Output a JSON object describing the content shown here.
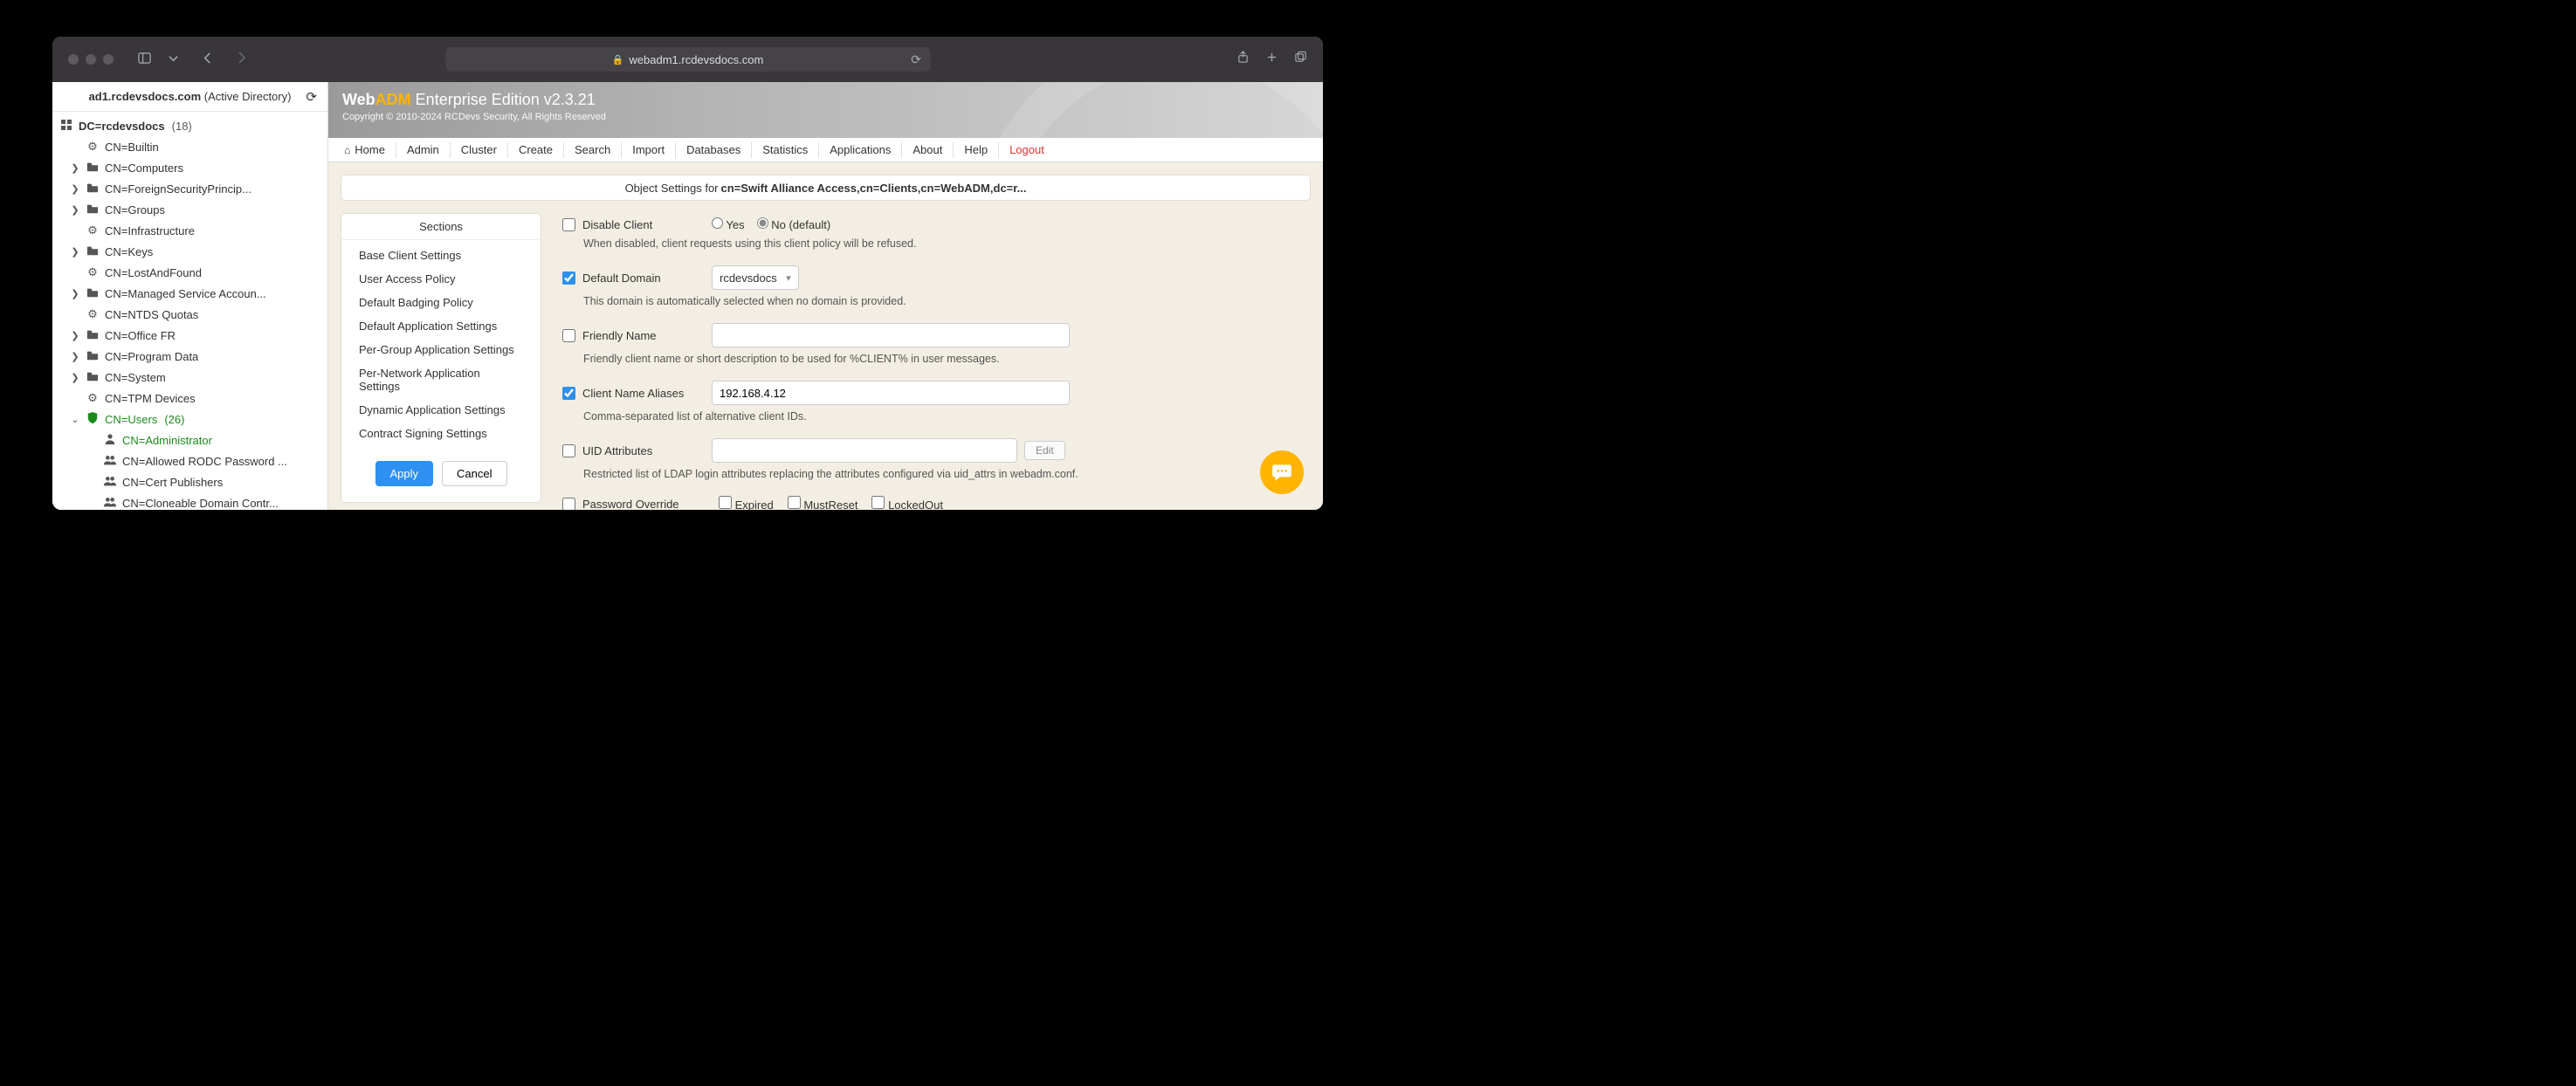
{
  "browser": {
    "url_host": "webadm1.rcdevsdocs.com"
  },
  "left_pane": {
    "header_domain": "ad1.rcdevsdocs.com",
    "header_suffix": " (Active Directory)",
    "root": {
      "label": "DC=rcdevsdocs",
      "count": "(18)"
    },
    "nodes": [
      {
        "icon": "globes",
        "label": "CN=Builtin",
        "chev": "none",
        "depth": 1
      },
      {
        "icon": "folder",
        "label": "CN=Computers",
        "chev": "right",
        "depth": 1
      },
      {
        "icon": "folder",
        "label": "CN=ForeignSecurityPrincip...",
        "chev": "right",
        "depth": 1
      },
      {
        "icon": "folder",
        "label": "CN=Groups",
        "chev": "right",
        "depth": 1
      },
      {
        "icon": "globes",
        "label": "CN=Infrastructure",
        "chev": "none",
        "depth": 1
      },
      {
        "icon": "folder",
        "label": "CN=Keys",
        "chev": "right",
        "depth": 1
      },
      {
        "icon": "globes",
        "label": "CN=LostAndFound",
        "chev": "none",
        "depth": 1
      },
      {
        "icon": "folder",
        "label": "CN=Managed Service Accoun...",
        "chev": "right",
        "depth": 1
      },
      {
        "icon": "globes",
        "label": "CN=NTDS Quotas",
        "chev": "none",
        "depth": 1
      },
      {
        "icon": "folder",
        "label": "CN=Office FR",
        "chev": "right",
        "depth": 1
      },
      {
        "icon": "folder",
        "label": "CN=Program Data",
        "chev": "right",
        "depth": 1
      },
      {
        "icon": "folder",
        "label": "CN=System",
        "chev": "right",
        "depth": 1
      },
      {
        "icon": "globes",
        "label": "CN=TPM Devices",
        "chev": "none",
        "depth": 1
      },
      {
        "icon": "shield",
        "label": "CN=Users",
        "count": "(26)",
        "chev": "down",
        "depth": 1,
        "green": true
      },
      {
        "icon": "user",
        "label": "CN=Administrator",
        "chev": "none",
        "depth": 2,
        "greenSolid": true
      },
      {
        "icon": "users",
        "label": "CN=Allowed RODC Password ...",
        "chev": "none",
        "depth": 2
      },
      {
        "icon": "users",
        "label": "CN=Cert Publishers",
        "chev": "none",
        "depth": 2
      },
      {
        "icon": "users",
        "label": "CN=Cloneable Domain Contr...",
        "chev": "none",
        "depth": 2
      }
    ]
  },
  "banner": {
    "prefix": "Web",
    "adm": "ADM",
    "rest": " Enterprise Edition v2.3.21",
    "copyright": "Copyright © 2010-2024 RCDevs Security, All Rights Reserved"
  },
  "nav": {
    "home": "Home",
    "items": [
      "Admin",
      "Cluster",
      "Create",
      "Search",
      "Import",
      "Databases",
      "Statistics",
      "Applications",
      "About",
      "Help"
    ],
    "logout": "Logout"
  },
  "notice": {
    "prefix": "Object Settings for ",
    "bold": "cn=Swift Alliance Access,cn=Clients,cn=WebADM,dc=r..."
  },
  "sections": {
    "header": "Sections",
    "items": [
      "Base Client Settings",
      "User Access Policy",
      "Default Badging Policy",
      "Default Application Settings",
      "Per-Group Application Settings",
      "Per-Network Application Settings",
      "Dynamic Application Settings",
      "Contract Signing Settings"
    ],
    "apply": "Apply",
    "cancel": "Cancel"
  },
  "form": {
    "disable_client": {
      "label": "Disable Client",
      "yes": "Yes",
      "no": "No (default)",
      "help": "When disabled, client requests using this client policy will be refused."
    },
    "default_domain": {
      "label": "Default Domain",
      "value": "rcdevsdocs",
      "help": "This domain is automatically selected when no domain is provided."
    },
    "friendly_name": {
      "label": "Friendly Name",
      "value": "",
      "help": "Friendly client name or short description to be used for %CLIENT% in user messages."
    },
    "aliases": {
      "label": "Client Name Aliases",
      "value": "192.168.4.12",
      "help": "Comma-separated list of alternative client IDs."
    },
    "uid_attrs": {
      "label": "UID Attributes",
      "value": "",
      "edit": "Edit",
      "help": "Restricted list of LDAP login attributes replacing the attributes configured via uid_attrs in webadm.conf."
    },
    "pwd_override": {
      "label": "Password Override",
      "opts": [
        "Expired",
        "MustReset",
        "LockedOut"
      ]
    }
  }
}
